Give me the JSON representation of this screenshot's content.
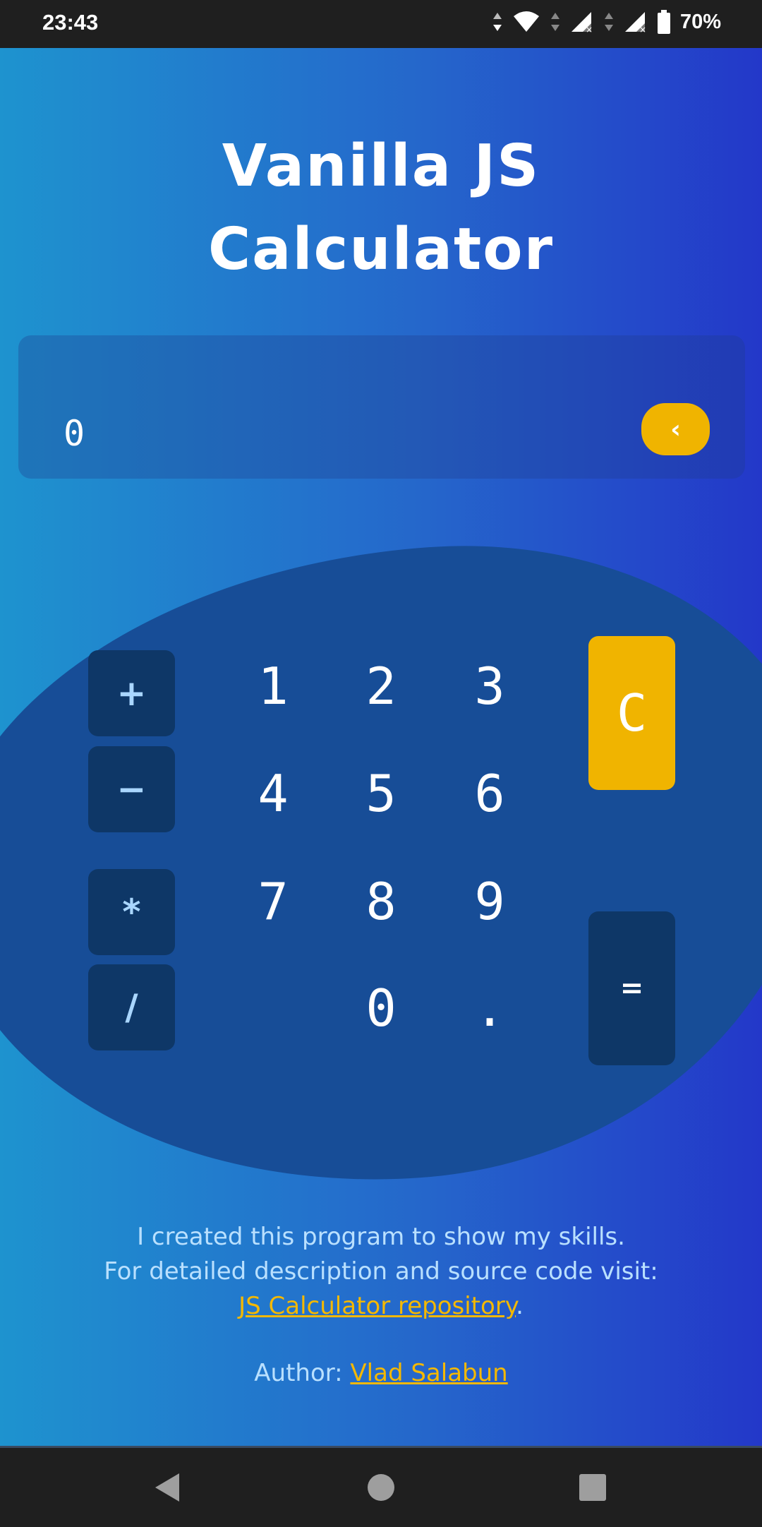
{
  "status_bar": {
    "time": "23:43",
    "battery": "70%",
    "icons": [
      "data-arrows-icon",
      "wifi-icon",
      "signal-icon",
      "signal-icon",
      "battery-icon"
    ]
  },
  "app": {
    "title_line1": "Vanilla JS",
    "title_line2": "Calculator"
  },
  "display": {
    "value": "0",
    "backspace_label": "‹"
  },
  "keypad": {
    "operators": {
      "add": "+",
      "subtract": "−",
      "multiply": "*",
      "divide": "/"
    },
    "digits": {
      "d1": "1",
      "d2": "2",
      "d3": "3",
      "d4": "4",
      "d5": "5",
      "d6": "6",
      "d7": "7",
      "d8": "8",
      "d9": "9",
      "d0": "0",
      "dot": "."
    },
    "clear": "C",
    "equals": "="
  },
  "footer": {
    "line1": "I created this program to show my skills.",
    "line2": "For detailed description and source code visit:",
    "repo_link": "JS Calculator repository",
    "period": ".",
    "author_label": "Author: ",
    "author_link": "Vlad Salabun"
  },
  "colors": {
    "accent": "#f0b400",
    "button_dark": "#0e3767",
    "blob": "#174d97",
    "operator_text": "#a9d6ff"
  },
  "nav_bar": {
    "icons": [
      "back-icon",
      "home-icon",
      "recents-icon"
    ]
  }
}
